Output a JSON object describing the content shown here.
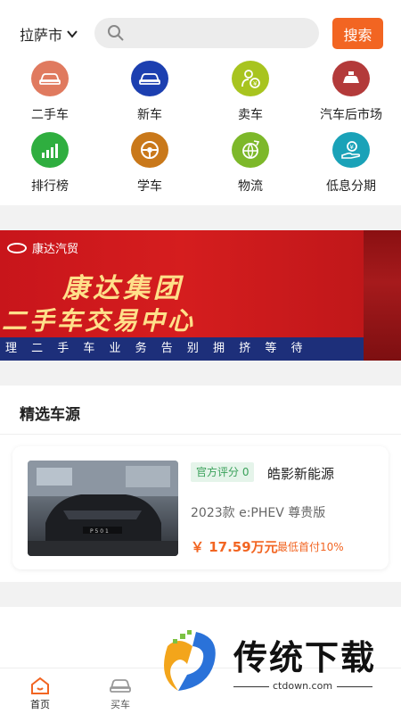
{
  "header": {
    "city": "拉萨市",
    "search_placeholder": "",
    "search_button": "搜索"
  },
  "categories": [
    {
      "label": "二手车",
      "icon": "used-car-icon",
      "color": "#e07a5f"
    },
    {
      "label": "新车",
      "icon": "new-car-icon",
      "color": "#1c3fb0"
    },
    {
      "label": "卖车",
      "icon": "sell-car-icon",
      "color": "#a8c41f"
    },
    {
      "label": "汽车后市场",
      "icon": "aftermarket-icon",
      "color": "#b33a3a"
    },
    {
      "label": "排行榜",
      "icon": "ranking-icon",
      "color": "#2fae3f"
    },
    {
      "label": "学车",
      "icon": "steering-wheel-icon",
      "color": "#c9781a"
    },
    {
      "label": "物流",
      "icon": "logistics-icon",
      "color": "#7db82a"
    },
    {
      "label": "低息分期",
      "icon": "installment-icon",
      "color": "#1aa2b8"
    }
  ],
  "banner": {
    "brand": "康达汽贸",
    "line1": "康达集团",
    "line2": "二手车交易中心",
    "line3": "理 二 手 车 业 务  告 别 拥 挤 等 待"
  },
  "featured": {
    "title": "精选车源",
    "items": [
      {
        "score": "官方评分 0",
        "name": "皓影新能源",
        "model": "2023款 e:PHEV 尊贵版",
        "price": "￥ 17.59万元",
        "down_payment": "最低首付10%"
      }
    ]
  },
  "tabbar": {
    "tabs": [
      {
        "label": "首页",
        "active": true
      },
      {
        "label": "买车",
        "active": false
      }
    ]
  },
  "watermark": {
    "text": "传统下载",
    "url": "ctdown.com"
  },
  "colors": {
    "accent": "#f26522",
    "score_green": "#3aa15a"
  }
}
